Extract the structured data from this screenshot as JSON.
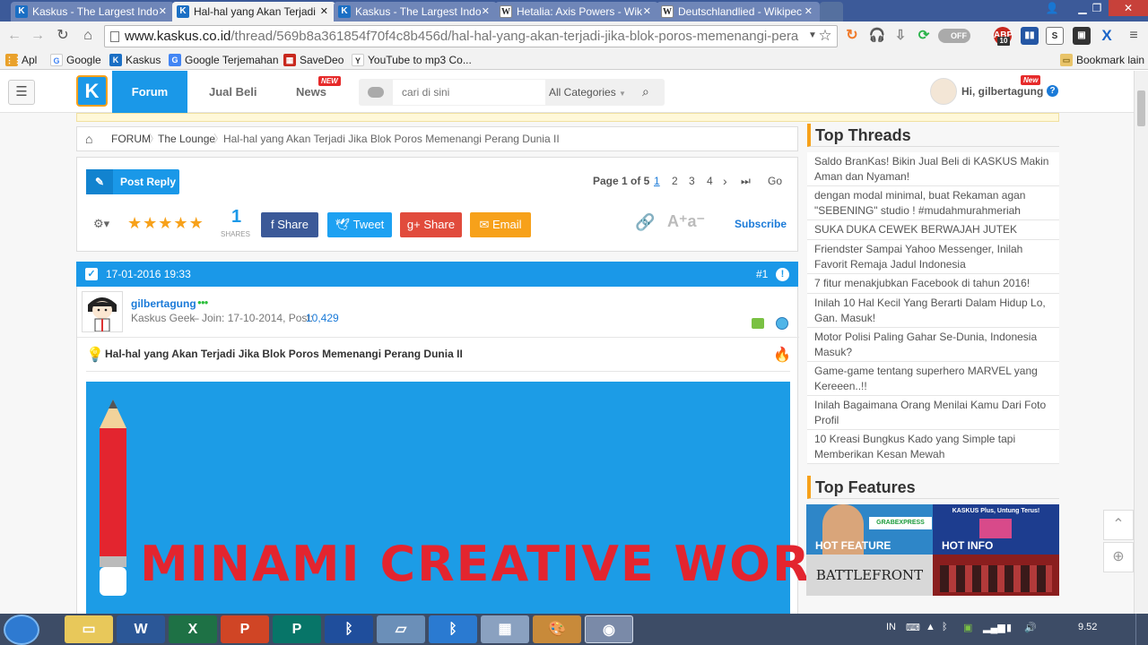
{
  "browser": {
    "tabs": [
      {
        "title": "Kaskus - The Largest Indo",
        "icon": "K",
        "active": false
      },
      {
        "title": "Hal-hal yang Akan Terjadi",
        "icon": "K",
        "active": true
      },
      {
        "title": "Kaskus - The Largest Indo",
        "icon": "K",
        "active": false
      },
      {
        "title": "Hetalia: Axis Powers - Wik",
        "icon": "W",
        "active": false
      },
      {
        "title": "Deutschlandlied - Wikipec",
        "icon": "W",
        "active": false
      }
    ],
    "url_host": "www.kaskus.co.id",
    "url_path": "/thread/569b8a361854f70f4c8b456d/hal-hal-yang-akan-terjadi-jika-blok-poros-memenangi-pera",
    "toggle_label": "OFF",
    "ext_badge": "10",
    "bookmarks": [
      "Apl",
      "Google",
      "Kaskus",
      "Google Terjemahan",
      "SaveDeo",
      "YouTube to mp3 Co...",
      "Bookmark lain"
    ]
  },
  "site": {
    "logo": "K",
    "nav": {
      "forum": "Forum",
      "jual_beli": "Jual Beli",
      "news": "News",
      "new_badge": "NEW"
    },
    "search_placeholder": "cari di sini",
    "category": "All Categories",
    "greeting": "Hi, gilbertagung",
    "user_new_badge": "New"
  },
  "breadcrumb": {
    "forum": "FORUM",
    "lounge": "The Lounge",
    "thread": "Hal-hal yang Akan Terjadi Jika Blok Poros Memenangi Perang Dunia II"
  },
  "actions": {
    "post_reply": "Post Reply",
    "page_label": "Page 1 of 5",
    "pages": [
      "1",
      "2",
      "3",
      "4"
    ],
    "go": "Go",
    "rating": 5,
    "share_count": "1",
    "shares_label": "SHARES",
    "facebook": "Share",
    "twitter": "Tweet",
    "gplus": "Share",
    "email": "Email",
    "subscribe": "Subscribe"
  },
  "post": {
    "date": "17-01-2016 19:33",
    "number": "#1",
    "username": "gilbertagung",
    "rank": "Kaskus Geek",
    "join_prefix": "– Join: 17-10-2014, Post:",
    "post_count": "10,429",
    "title": "Hal-hal yang Akan Terjadi Jika Blok Poros Memenangi Perang Dunia II",
    "banner_text": "MINAMI CREATIVE WORKS"
  },
  "sidebar": {
    "top_threads_title": "Top Threads",
    "threads": [
      "Saldo BranKas! Bikin Jual Beli di KASKUS Makin Aman dan Nyaman!",
      "dengan modal minimal, buat Rekaman agan \"SEBENING\" studio ! #mudahmurahmeriah",
      "SUKA DUKA CEWEK BERWAJAH JUTEK",
      "Friendster Sampai Yahoo Messenger, Inilah Favorit Remaja Jadul Indonesia",
      "7 fitur menakjubkan Facebook di tahun 2016!",
      "Inilah 10 Hal Kecil Yang Berarti Dalam Hidup Lo, Gan. Masuk!",
      "Motor Polisi Paling Gahar Se-Dunia, Indonesia Masuk?",
      "Game-game tentang superhero MARVEL yang Kereeen..!!",
      "Inilah Bagaimana Orang Menilai Kamu Dari Foto Profil",
      "10 Kreasi Bungkus Kado yang Simple tapi Memberikan Kesan Mewah"
    ],
    "top_features_title": "Top Features",
    "features": [
      {
        "label": "HOT FEATURE",
        "caption": "GRABEXPRESS"
      },
      {
        "label": "HOT INFO",
        "caption": "KASKUS Plus, Untung Terus!"
      },
      {
        "label": "",
        "caption": "BATTLEFRONT"
      },
      {
        "label": "",
        "caption": ""
      }
    ]
  },
  "taskbar": {
    "lang": "IN",
    "time": "9.52"
  }
}
